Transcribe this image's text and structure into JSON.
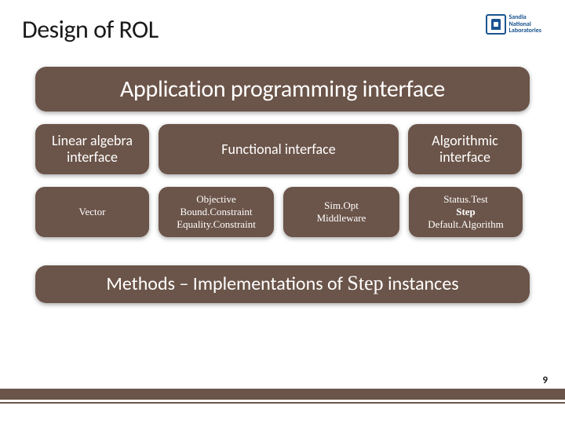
{
  "header": {
    "title": "Design of ROL",
    "logo_line1": "Sandia",
    "logo_line2": "National",
    "logo_line3": "Laboratories"
  },
  "diagram": {
    "banner_top": "Application programming interface",
    "row2": {
      "linear_algebra_l1": "Linear algebra",
      "linear_algebra_l2": "interface",
      "functional": "Functional interface",
      "algorithmic_l1": "Algorithmic",
      "algorithmic_l2": "interface"
    },
    "row3": {
      "vector": "Vector",
      "objective_l1": "Objective",
      "objective_l2": "Bound.Constraint",
      "objective_l3": "Equality.Constraint",
      "simopt_l1": "Sim.Opt",
      "simopt_l2": "Middleware",
      "status_l1": "Status.Test",
      "status_l2": "Step",
      "status_l3": "Default.Algorithm"
    },
    "banner_bottom_pre": "Methods – Implementations of ",
    "banner_bottom_step": "Step",
    "banner_bottom_post": " instances"
  },
  "page_number": "9"
}
